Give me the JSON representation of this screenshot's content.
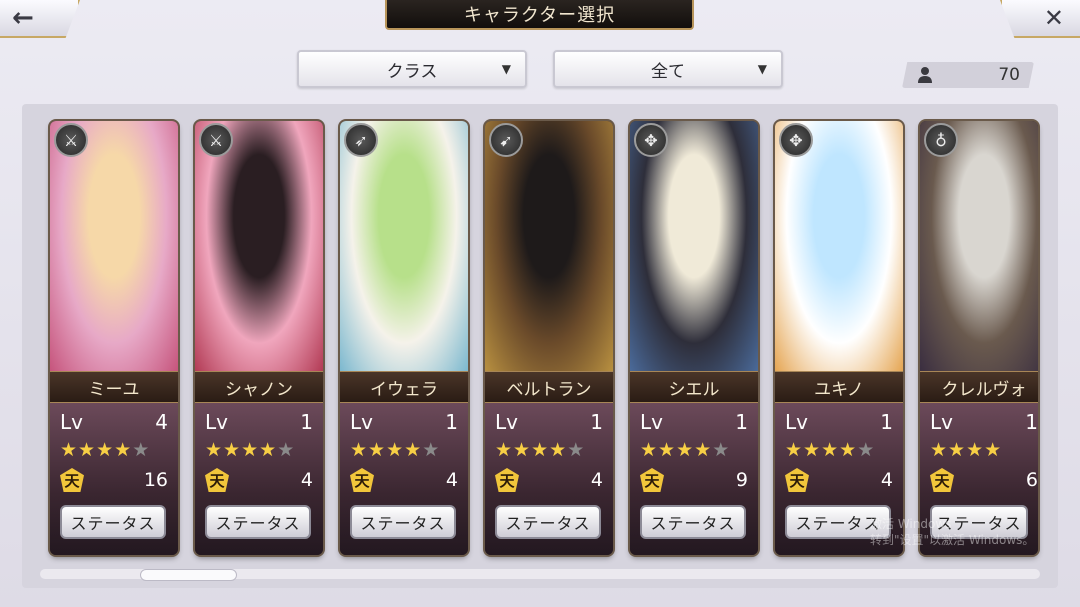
{
  "header": {
    "title": "キャラクター選択",
    "back_icon": "←",
    "close_icon": "✕"
  },
  "filters": {
    "class_label": "クラス",
    "all_label": "全て",
    "caret": "▼"
  },
  "owned": {
    "icon": "person-icon",
    "count": "70"
  },
  "ui": {
    "level_label": "Lv",
    "status_button": "ステータス",
    "ten_glyph": "天"
  },
  "characters": [
    {
      "name": "ミーユ",
      "level": "4",
      "stars": 4,
      "max_stars": 5,
      "ten": "16",
      "class_icon": "sword-icon",
      "class_glyph": "⚔",
      "colors": [
        "#f6d8a8",
        "#e7a9c7",
        "#c6547c"
      ]
    },
    {
      "name": "シャノン",
      "level": "1",
      "stars": 4,
      "max_stars": 5,
      "ten": "4",
      "class_icon": "sword-icon",
      "class_glyph": "⚔",
      "colors": [
        "#2a1e22",
        "#f0a6bd",
        "#b23a54"
      ]
    },
    {
      "name": "イウェラ",
      "level": "1",
      "stars": 4,
      "max_stars": 5,
      "ten": "4",
      "class_icon": "bow-icon",
      "class_glyph": "➶",
      "colors": [
        "#b7e08a",
        "#f5f2ea",
        "#7bb8cf"
      ]
    },
    {
      "name": "ベルトラン",
      "level": "1",
      "stars": 4,
      "max_stars": 5,
      "ten": "4",
      "class_icon": "lance-icon",
      "class_glyph": "➹",
      "colors": [
        "#1e1a1a",
        "#6a4a2a",
        "#b89040"
      ]
    },
    {
      "name": "シエル",
      "level": "1",
      "stars": 4,
      "max_stars": 5,
      "ten": "9",
      "class_icon": "crossbow-icon",
      "class_glyph": "✥",
      "colors": [
        "#f0ead8",
        "#2e2e3a",
        "#4a6a9a"
      ]
    },
    {
      "name": "ユキノ",
      "level": "1",
      "stars": 4,
      "max_stars": 5,
      "ten": "4",
      "class_icon": "crossbow-icon",
      "class_glyph": "✥",
      "colors": [
        "#bfe6ff",
        "#ffffff",
        "#e5a552"
      ]
    },
    {
      "name": "クレルヴォ",
      "level": "1",
      "stars": 4,
      "max_stars": 4,
      "ten": "6",
      "class_icon": "staff-icon",
      "class_glyph": "♁",
      "colors": [
        "#d9d6d0",
        "#6a5a4e",
        "#3a2e40"
      ]
    }
  ],
  "scrollbar": {
    "position": 0.1
  },
  "watermark": {
    "line1": "激活 Windows",
    "line2": "转到\"设置\"以激活 Windows。"
  }
}
